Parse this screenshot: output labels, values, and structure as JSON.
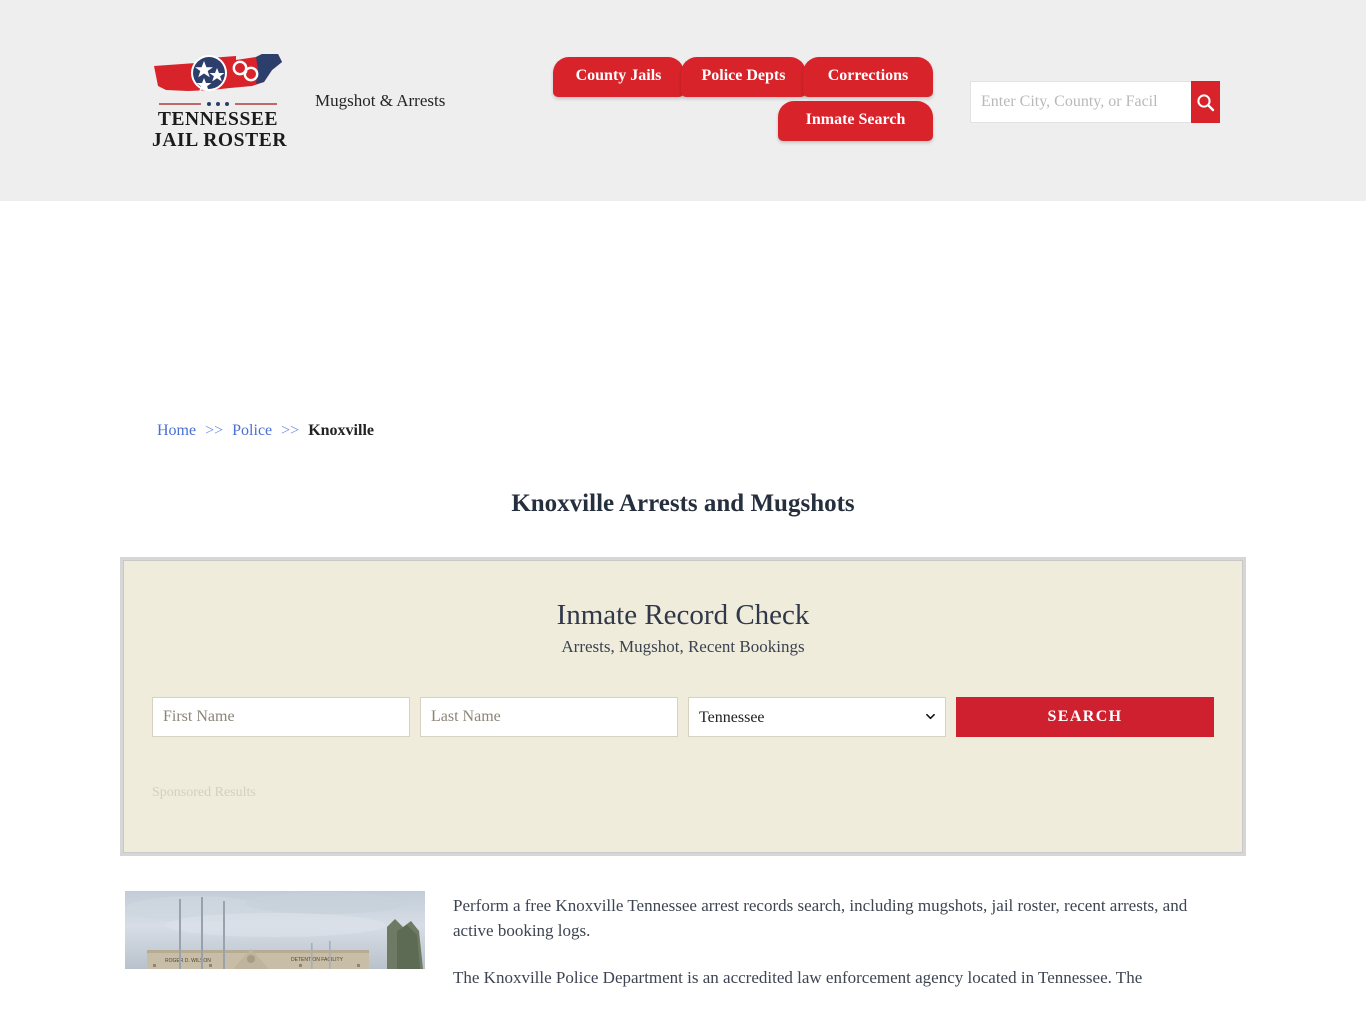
{
  "site": {
    "logo_line1": "TENNESSEE",
    "logo_line2": "JAIL ROSTER",
    "logo_icon": "tennessee-state-handcuffs-logo",
    "tagline": "Mugshot & Arrests",
    "brand_red": "#d8232a",
    "brand_navy": "#2c3e6b"
  },
  "nav": {
    "items": [
      {
        "label": "County Jails"
      },
      {
        "label": "Police Depts"
      },
      {
        "label": "Corrections"
      },
      {
        "label": "Inmate Search"
      }
    ]
  },
  "header_search": {
    "value": "",
    "placeholder": "Enter City, County, or Facil",
    "button_icon": "search-icon"
  },
  "breadcrumb": {
    "home": "Home",
    "sep1": ">>",
    "police": "Police",
    "sep2": ">>",
    "current": "Knoxville"
  },
  "page": {
    "title": "Knoxville Arrests and Mugshots"
  },
  "record_check": {
    "title": "Inmate Record Check",
    "subtitle": "Arrests, Mugshot, Recent Bookings",
    "first_name_placeholder": "First Name",
    "first_name_value": "",
    "last_name_placeholder": "Last Name",
    "last_name_value": "",
    "state_selected": "Tennessee",
    "state_options": [
      "Tennessee"
    ],
    "search_button": "SEARCH",
    "sponsored_label": "Sponsored Results",
    "panel_bg": "#efecdc",
    "button_color": "#cf2030"
  },
  "content": {
    "photo_alt": "roger-d-wilson-detention-facility-photo",
    "photo_sign_left": "ROGER D. WILSON",
    "photo_sign_right": "DETENTION  FACILITY",
    "paragraph1": "Perform a free Knoxville Tennessee arrest records search, including mugshots, jail roster, recent arrests, and active booking logs.",
    "paragraph2": "The Knoxville Police Department is an accredited law enforcement agency located in Tennessee. The"
  }
}
